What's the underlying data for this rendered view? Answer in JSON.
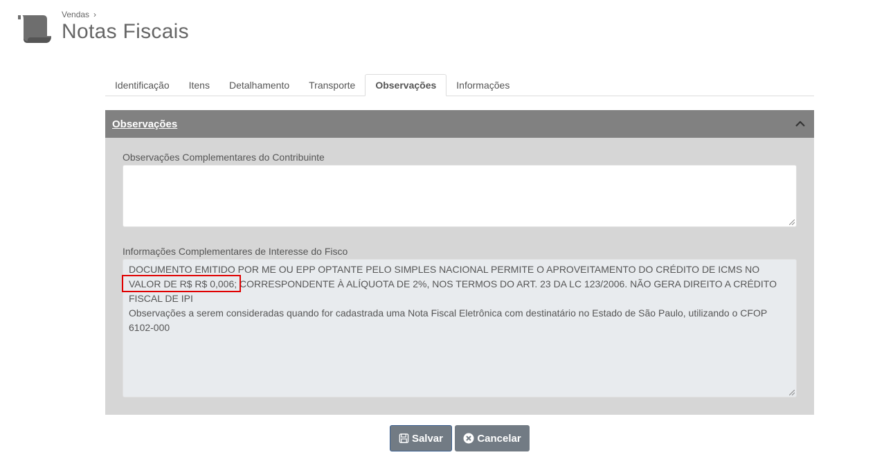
{
  "breadcrumb": {
    "parent": "Vendas",
    "separator": "›"
  },
  "page": {
    "title": "Notas Fiscais"
  },
  "tabs": [
    {
      "label": "Identificação",
      "active": false
    },
    {
      "label": "Itens",
      "active": false
    },
    {
      "label": "Detalhamento",
      "active": false
    },
    {
      "label": "Transporte",
      "active": false
    },
    {
      "label": "Observações",
      "active": true
    },
    {
      "label": "Informações",
      "active": false
    }
  ],
  "panel": {
    "title": "Observações",
    "collapse_icon": "chevron-up-icon",
    "field1": {
      "label": "Observações Complementares do Contribuinte",
      "value": ""
    },
    "field2": {
      "label": "Informações Complementares de Interesse do Fisco",
      "lines": [
        "DOCUMENTO EMITIDO POR ME OU EPP OPTANTE PELO SIMPLES NACIONAL PERMITE O APROVEITAMENTO DO CRÉDITO DE ICMS NO",
        "VALOR DE R$ R$ 0,006; CORRESPONDENTE À ALÍQUOTA DE 2%, NOS TERMOS DO ART. 23 DA LC 123/2006. NÃO GERA DIREITO A CRÉDITO",
        "FISCAL DE IPI",
        "Observações a serem consideradas quando for cadastrada uma Nota Fiscal Eletrônica com destinatário no Estado de São Paulo, utilizando o CFOP",
        "6102-000"
      ]
    }
  },
  "buttons": {
    "save_label": "Salvar",
    "save_icon": "floppy-disk-icon",
    "cancel_label": "Cancelar",
    "cancel_icon": "close-circle-icon"
  },
  "colors": {
    "panel_header": "#818181",
    "panel_body": "#d6d6d6",
    "button": "#727b84",
    "highlight": "#e00000"
  }
}
